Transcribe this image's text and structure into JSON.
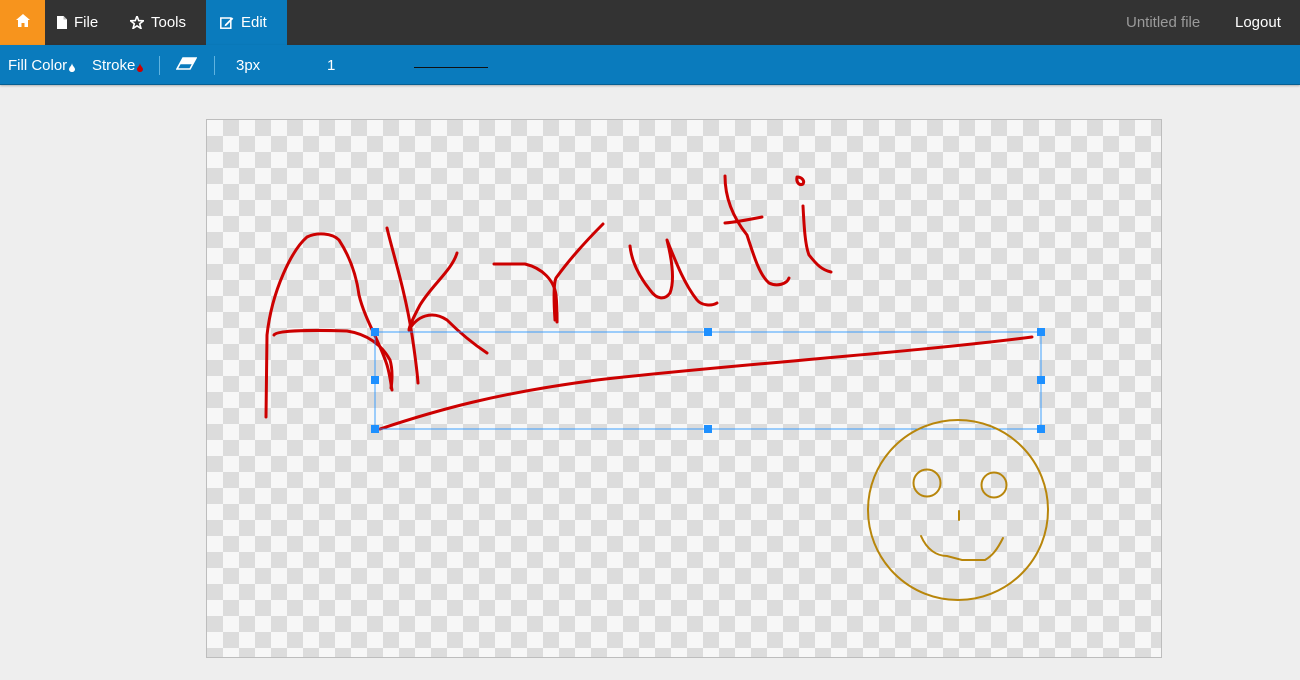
{
  "app": {
    "nav": {
      "file_label": "File",
      "tools_label": "Tools",
      "edit_label": "Edit"
    },
    "file_name": "Untitled file",
    "logout_label": "Logout"
  },
  "toolbar": {
    "fill_label": "Fill Color",
    "stroke_label": "Stroke",
    "stroke_width": "3px",
    "opacity": "1"
  },
  "colors": {
    "nav_background": "#333333",
    "home_accent": "#f7941d",
    "toolbar_blue": "#0a7bbd",
    "stroke_color": "#cc0000",
    "smiley_color": "#b8860b",
    "selection_color": "#1e90ff"
  },
  "icons": {
    "home": "home-icon",
    "file": "file-icon",
    "tools": "tools-icon",
    "edit": "edit-icon",
    "eraser": "eraser-icon",
    "drop": "color-drop-icon"
  }
}
